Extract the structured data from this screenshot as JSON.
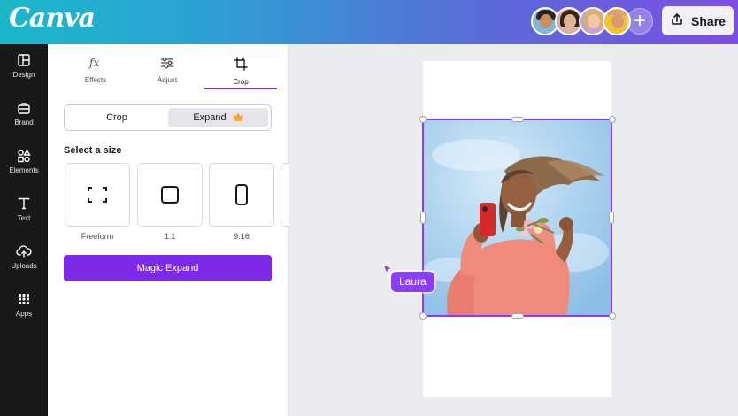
{
  "app": {
    "logo": "Canva",
    "share_label": "Share",
    "add_collaborator": "+"
  },
  "rail": [
    {
      "label": "Design",
      "icon": "layout-icon"
    },
    {
      "label": "Brand",
      "icon": "briefcase-icon"
    },
    {
      "label": "Elements",
      "icon": "shapes-icon"
    },
    {
      "label": "Text",
      "icon": "text-t-icon"
    },
    {
      "label": "Uploads",
      "icon": "cloud-upload-icon"
    },
    {
      "label": "Apps",
      "icon": "apps-grid-icon"
    }
  ],
  "panel": {
    "tabs": [
      {
        "label": "Effects",
        "icon": "fx-icon"
      },
      {
        "label": "Adjust",
        "icon": "sliders-icon"
      },
      {
        "label": "Crop",
        "icon": "crop-icon"
      }
    ],
    "active_tab": "Crop",
    "mode": {
      "crop_label": "Crop",
      "expand_label": "Expand",
      "selected": "Expand",
      "expand_badge": "crown-icon"
    },
    "size_heading": "Select a size",
    "sizes": [
      {
        "label": "Freeform",
        "icon": "freeform-corners-icon"
      },
      {
        "label": "1:1",
        "icon": "square-icon"
      },
      {
        "label": "9:16",
        "icon": "portrait-rect-icon"
      }
    ],
    "magic_expand_label": "Magic Expand"
  },
  "canvas": {
    "collaborator_cursor_name": "Laura"
  },
  "colors": {
    "accent": "#7d2ae8",
    "selection": "#8b3dff",
    "rail_bg": "#18191b",
    "crown": "#f0a52a"
  }
}
